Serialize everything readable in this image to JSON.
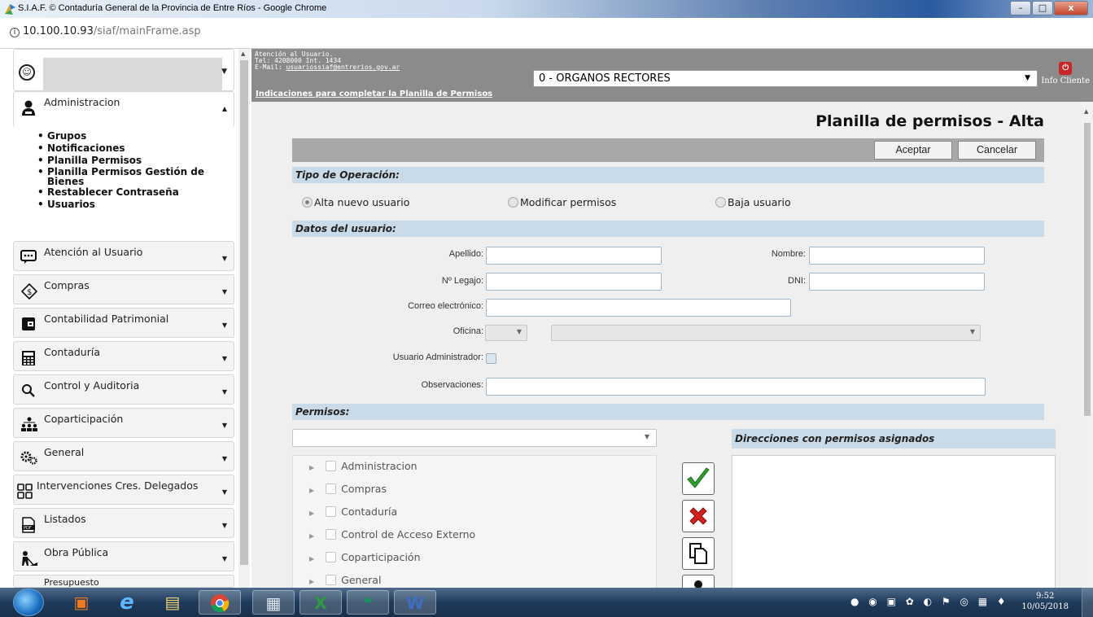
{
  "window": {
    "title": "S.I.A.F. © Contaduría General de la Provincia de Entre Ríos - Google Chrome"
  },
  "address": {
    "host": "10.100.10.93",
    "path": "/siaf/mainFrame.asp"
  },
  "sidebar": {
    "open_menu": "Administracion",
    "submenu": [
      "Grupos",
      "Notificaciones",
      "Planilla Permisos",
      "Planilla Permisos Gestión de Bienes",
      "Restablecer Contraseña",
      "Usuarios"
    ],
    "menus": [
      {
        "label": "Atención al Usuario",
        "icon": "chat-icon"
      },
      {
        "label": "Compras",
        "icon": "tag-icon"
      },
      {
        "label": "Contabilidad Patrimonial",
        "icon": "wallet-icon"
      },
      {
        "label": "Contaduría",
        "icon": "calculator-icon"
      },
      {
        "label": "Control y Auditoria",
        "icon": "magnifier-icon"
      },
      {
        "label": "Coparticipación",
        "icon": "people-network-icon"
      },
      {
        "label": "General",
        "icon": "gears-icon"
      },
      {
        "label": "Intervenciones Cres. Delegados",
        "icon": "grid-icon"
      },
      {
        "label": "Listados",
        "icon": "pdf-icon"
      },
      {
        "label": "Obra Pública",
        "icon": "worker-icon"
      },
      {
        "label": "Presupuesto",
        "icon": "budget-icon"
      }
    ]
  },
  "header": {
    "atencion_line1": "Atención al Usuario.",
    "atencion_line2": "Tel: 4208000 Int. 1434",
    "email_label": "E-Mail: ",
    "email": "usuariossiaf@entrerios.gov.ar",
    "indicaciones": "Indicaciones para completar la Planilla de Permisos",
    "organismo": "0 - ORGANOS RECTORES",
    "info_cliente": "Info Cliente"
  },
  "form": {
    "title": "Planilla de permisos - Alta",
    "aceptar": "Aceptar",
    "cancelar": "Cancelar",
    "tipo_operacion": "Tipo de Operación:",
    "op_alta": "Alta nuevo usuario",
    "op_modificar": "Modificar permisos",
    "op_baja": "Baja usuario",
    "datos_usuario": "Datos del usuario:",
    "apellido": "Apellido:",
    "nombre": "Nombre:",
    "legajo": "Nº Legajo:",
    "dni": "DNI:",
    "correo": "Correo electrónico:",
    "oficina": "Oficina:",
    "usuario_admin": "Usuario Administrador:",
    "observaciones": "Observaciones:",
    "permisos": "Permisos:",
    "direcciones": "Direcciones con permisos asignados",
    "tree": [
      "Administracion",
      "Compras",
      "Contaduría",
      "Control de Acceso Externo",
      "Coparticipación",
      "General"
    ]
  },
  "taskbar": {
    "time": "9:52",
    "date": "10/05/2018"
  },
  "colors": {
    "section_bg": "#c9dbe8",
    "header_bg": "#8b8b8b",
    "accept_icon": "#2e9e2e",
    "reject_icon": "#d02020"
  }
}
